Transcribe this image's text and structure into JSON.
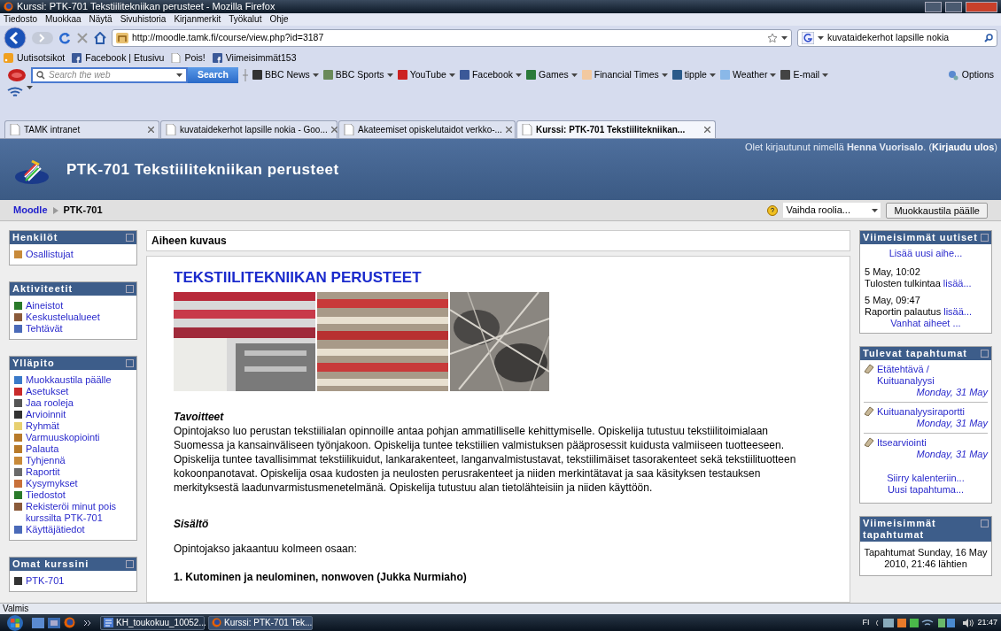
{
  "window": {
    "title": "Kurssi: PTK-701 Tekstiilitekniikan perusteet - Mozilla Firefox"
  },
  "menu": [
    "Tiedosto",
    "Muokkaa",
    "Näytä",
    "Sivuhistoria",
    "Kirjanmerkit",
    "Työkalut",
    "Ohje"
  ],
  "nav": {
    "url": "http://moodle.tamk.fi/course/view.php?id=3187",
    "search_value": "kuvataidekerhot lapsille nokia"
  },
  "bookmarks": [
    {
      "label": "Uutisotsikot",
      "kind": "feed"
    },
    {
      "label": "Facebook | Etusivu",
      "kind": "facebook"
    },
    {
      "label": "Pois!",
      "kind": "page"
    },
    {
      "label": "Viimeisimmät153",
      "kind": "facebook"
    }
  ],
  "ask_toolbar": {
    "placeholder": "Search the web",
    "button": "Search",
    "items": [
      {
        "label": "BBC News",
        "color": "#333333"
      },
      {
        "label": "BBC Sports",
        "color": "#6a8a5a"
      },
      {
        "label": "YouTube",
        "color": "#cc2222"
      },
      {
        "label": "Facebook",
        "color": "#3b5998"
      },
      {
        "label": "Games",
        "color": "#2a7a3a"
      },
      {
        "label": "Financial Times",
        "color": "#f2c9a0"
      },
      {
        "label": "tipple",
        "color": "#2a5a8a"
      },
      {
        "label": "Weather",
        "color": "#8ab8e8"
      },
      {
        "label": "E-mail",
        "color": "#444444"
      }
    ],
    "options": "Options"
  },
  "tabs": [
    {
      "label": "TAMK intranet",
      "selected": false
    },
    {
      "label": "kuvataidekerhot lapsille nokia - Goo...",
      "selected": false
    },
    {
      "label": "Akateemiset opiskelutaidot verkko-...",
      "selected": false
    },
    {
      "label": "Kurssi: PTK-701 Tekstiilitekniikan...",
      "selected": true
    }
  ],
  "header": {
    "title": "PTK-701 Tekstiilitekniikan perusteet",
    "login_text": "Olet kirjautunut nimellä **Henna Vuorisalo**. (",
    "logout": "Kirjaudu ulos",
    "login_end": ")"
  },
  "breadcrumb": [
    "Moodle",
    "PTK-701"
  ],
  "role_select": "Vaihda roolia...",
  "edit_button": "Muokkaustila päälle",
  "left_blocks": [
    {
      "title": "Henkilöt",
      "items": [
        "Osallistujat"
      ]
    },
    {
      "title": "Aktiviteetit",
      "items": [
        "Aineistot",
        "Keskustelualueet",
        "Tehtävät"
      ]
    },
    {
      "title": "Ylläpito",
      "items": [
        "Muokkaustila päälle",
        "Asetukset",
        "Jaa rooleja",
        "Arvioinnit",
        "Ryhmät",
        "Varmuuskopiointi",
        "Palauta",
        "Tyhjennä",
        "Raportit",
        "Kysymykset",
        "Tiedostot",
        "Rekisteröi minut pois kurssilta PTK-701",
        "Käyttäjätiedot"
      ]
    },
    {
      "title": "Omat kurssini",
      "items": [
        "PTK-701"
      ]
    }
  ],
  "main": {
    "section_title": "Aiheen kuvaus",
    "heading": "TEKSTIILITEKNIIKAN PERUSTEET",
    "goals_title": "Tavoitteet",
    "goals": "Opintojakso luo perustan tekstiilialan opinnoille antaa pohjan ammatilliselle kehittymiselle. Opiskelija tutustuu tekstiilitoimialaan Suomessa ja kansainväliseen työnjakoon. Opiskelija tuntee tekstiilien valmistuksen pääprosessit kuidusta valmiiseen tuotteeseen. Opiskelija tuntee tavallisimmat tekstiilikuidut, lankarakenteet, langanvalmistustavat, tekstiilimäiset tasorakenteet sekä tekstiilituotteen kokoonpanotavat. Opiskelija osaa kudosten ja neulosten perusrakenteet ja niiden merkintätavat ja saa käsityksen testauksen merkityksestä laadunvarmistusmenetelmänä. Opiskelija tutustuu alan tietolähteisiin ja niiden käyttöön.",
    "content_title": "Sisältö",
    "content_intro": "Opintojakso jakaantuu kolmeen osaan:",
    "part_1": "1. Kutominen ja neulominen, nonwoven (Jukka Nurmiaho)"
  },
  "news": {
    "title": "Viimeisimmät uutiset",
    "add": "Lisää uusi aihe...",
    "items": [
      {
        "date": "5 May, 10:02",
        "text": "Tulosten tulkintaa",
        "more": "lisää..."
      },
      {
        "date": "5 May, 09:47",
        "text": "Raportin palautus",
        "more": "lisää..."
      }
    ],
    "older": "Vanhat aiheet ..."
  },
  "events": {
    "title": "Tulevat tapahtumat",
    "items": [
      {
        "name": "Etätehtävä / Kuituanalyysi",
        "date": "Monday, 31 May"
      },
      {
        "name": "Kuituanalyysiraportti",
        "date": "Monday, 31 May"
      },
      {
        "name": "Itsearviointi",
        "date": "Monday, 31 May"
      }
    ],
    "calendar": "Siirry kalenteriin...",
    "new_event": "Uusi tapahtuma..."
  },
  "recent": {
    "title": "Viimeisimmät tapahtumat",
    "text": "Tapahtumat Sunday, 16 May 2010, 21:46 lähtien"
  },
  "status_bar": "Valmis",
  "taskbar": {
    "items": [
      "KH_toukokuu_10052...",
      "Kurssi: PTK-701 Tek..."
    ],
    "language": "FI",
    "clock": "21:47"
  }
}
